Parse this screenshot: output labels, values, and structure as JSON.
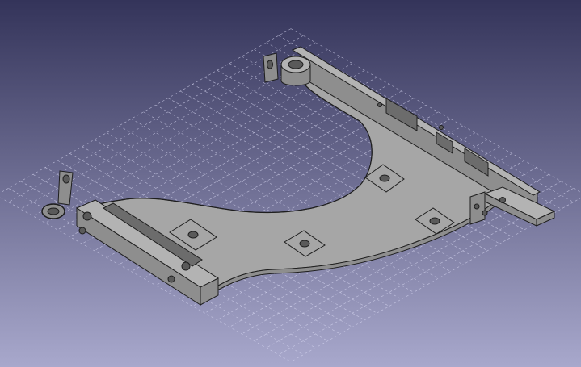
{
  "viewport": {
    "background_top": "#34345a",
    "background_bottom": "#a8a8cc",
    "grid_color": "#d8d8f2",
    "part_face_color": "#a6a6a6",
    "part_top_color": "#b3b3b3",
    "part_side_color": "#8e8e8e",
    "part_edge_color": "#1e1e1e"
  },
  "model": {
    "part_name": "bracket-plate",
    "features": [
      "mounting-hole",
      "ring-lug",
      "rail",
      "pocket",
      "slot"
    ]
  }
}
